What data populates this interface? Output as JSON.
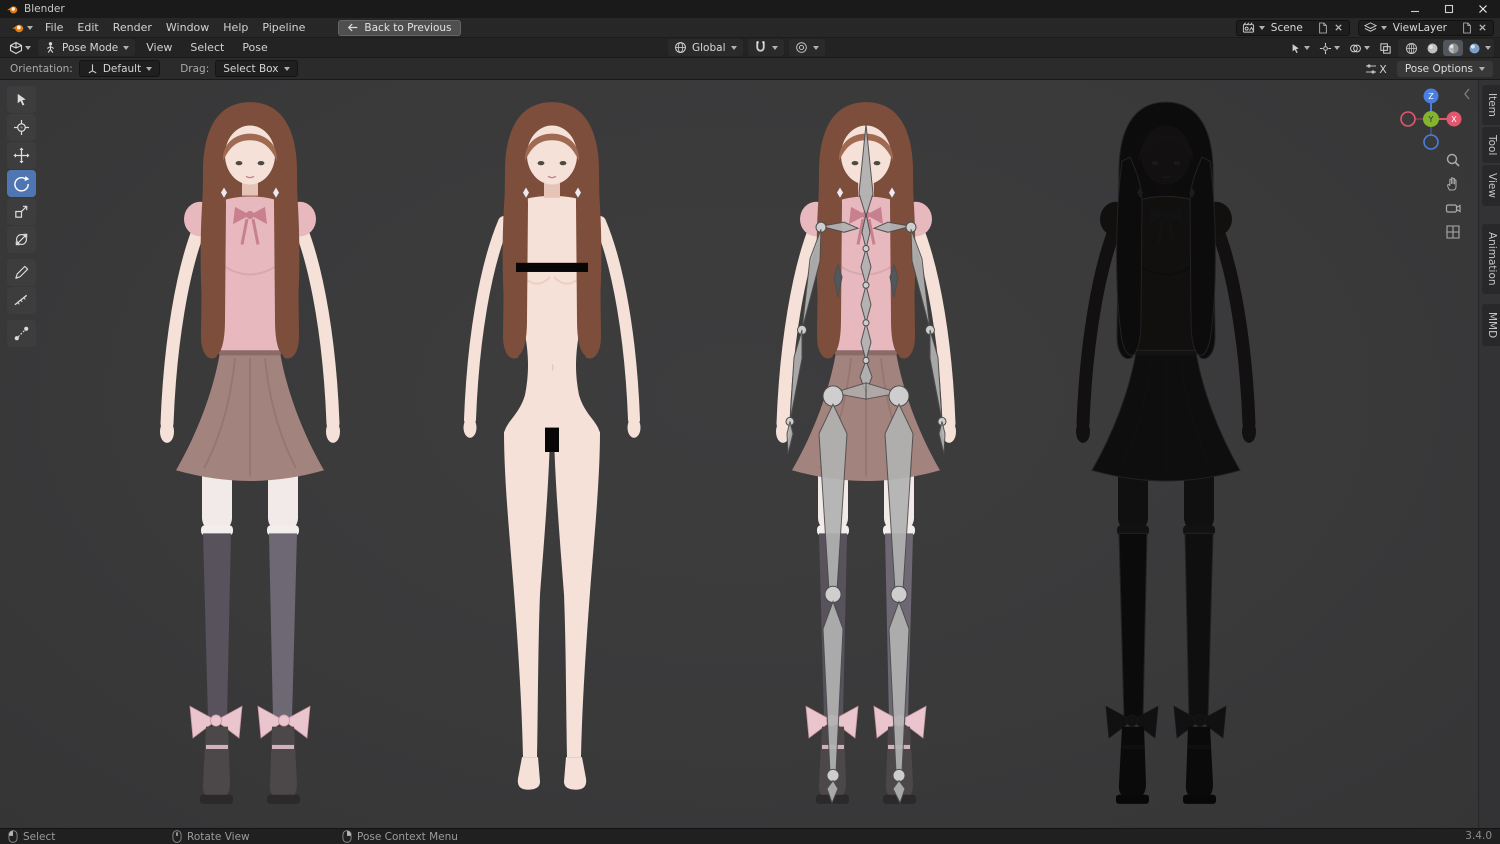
{
  "window": {
    "title": "Blender"
  },
  "topbar": {
    "menus": [
      "File",
      "Edit",
      "Render",
      "Window",
      "Help",
      "Pipeline"
    ],
    "back_button": "Back to Previous",
    "scene": {
      "label": "Scene"
    },
    "viewlayer": {
      "label": "ViewLayer"
    }
  },
  "viewport_header": {
    "mode": "Pose Mode",
    "menus": [
      "View",
      "Select",
      "Pose"
    ],
    "orientation": "Global"
  },
  "tool_settings": {
    "orientation_label": "Orientation:",
    "orientation_value": "Default",
    "drag_label": "Drag:",
    "drag_value": "Select Box",
    "clear_label": "X",
    "pose_options_label": "Pose Options"
  },
  "toolbar_tools": [
    "Select Box",
    "Cursor",
    "Move",
    "Rotate",
    "Scale",
    "Transform",
    "Annotate",
    "Measure",
    "Pose Breakdowner"
  ],
  "active_tool": "Rotate",
  "sidebar_tabs": [
    "Item",
    "Tool",
    "View",
    "Animation",
    "MMD"
  ],
  "gizmo_axes": {
    "x": "X",
    "y": "Y",
    "z": "Z"
  },
  "statusbar": {
    "hints": [
      "Select",
      "Rotate View",
      "Pose Context Menu"
    ],
    "version": "3.4.0"
  },
  "colors": {
    "accent": "#4f76b3",
    "titlebar_bg": "#1a1a1a",
    "menubar_bg": "#272727",
    "header_bg": "#232323",
    "toolsettings_bg": "#2b2b2b",
    "viewport_bg": "#3a3a3b",
    "statusbar_bg": "#202020",
    "text": "#d6d6d6",
    "text_dim": "#a9a9a9",
    "axis_x": "#e4566e",
    "axis_y": "#84b32f",
    "axis_z": "#4a7fe0",
    "skin": "#f5e1d8",
    "skin_shade": "#e6c3b7",
    "hair": "#7d4e3b",
    "hair_light": "#a06a52",
    "blouse": "#e7b9bf",
    "blouse_shade": "#cf9ca6",
    "ribbon": "#c8808f",
    "skirt": "#a3837d",
    "skirt_dark": "#8a6b66",
    "thigh": "#f2eae9",
    "stocking_left": "#57525b",
    "stocking_right": "#6e6874",
    "bow": "#eac5ce",
    "boot": "#4c4749",
    "bone": "#b2b2b2",
    "bone_stroke": "#4d4d4d",
    "censor": "#060606"
  }
}
